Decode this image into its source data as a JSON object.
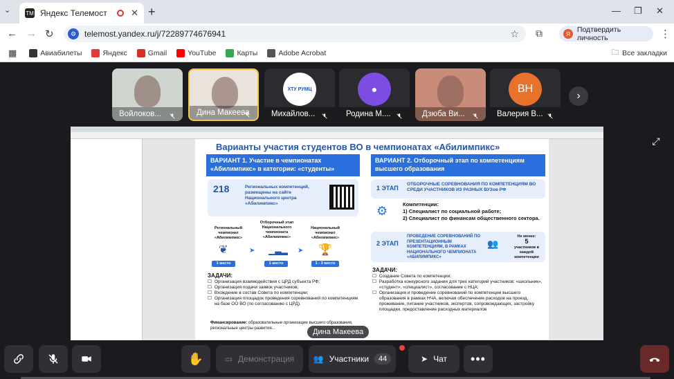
{
  "browser": {
    "tab_title": "Яндекс Телемост",
    "tab_icon": "TM",
    "url": "telemost.yandex.ru/j/72289774676941",
    "verify_label": "Подтвердить личность",
    "bookmarks": [
      {
        "label": "Авиабилеты",
        "icon": "plane-icon",
        "color": "#333333"
      },
      {
        "label": "Яндекс",
        "icon": "yandex-icon",
        "color": "#e03a3a"
      },
      {
        "label": "Gmail",
        "icon": "gmail-icon",
        "color": "#d93025"
      },
      {
        "label": "YouTube",
        "icon": "youtube-icon",
        "color": "#ff0000"
      },
      {
        "label": "Карты",
        "icon": "maps-icon",
        "color": "#34a853"
      },
      {
        "label": "Adobe Acrobat",
        "icon": "acrobat-icon",
        "color": "#555555"
      }
    ],
    "all_bookmarks": "Все закладки"
  },
  "participants": [
    {
      "name": "Войлоков...",
      "type": "photo",
      "color": "#cfd6cf"
    },
    {
      "name": "Дина Макеева",
      "type": "photo",
      "color": "#e9e3dc",
      "active": true
    },
    {
      "name": "Михайлов...",
      "type": "logo",
      "logo_text": "ХТУ РУМЦ",
      "color": "#ffffff"
    },
    {
      "name": "Родина М....",
      "type": "icon",
      "color": "#7b4de0"
    },
    {
      "name": "Дзюба Ви...",
      "type": "photo",
      "color": "#c98c7a"
    },
    {
      "name": "Валерия В...",
      "type": "initials",
      "initials": "ВН",
      "color": "#e8712c"
    }
  ],
  "slide": {
    "title": "Варианты участия студентов ВО в чемпионатах «Абилимпикс»",
    "variant1": "ВАРИАНТ 1. Участие в чемпионатах «Абилимпикс» в категории: «студенты»",
    "count": "218",
    "count_text": "Региональных компетенций, размещены на сайте Национального центра «Абилимпикс»",
    "step_regional": "Региональный чемпионат «Абилимпикс»",
    "step_qualify": "Отборочный этап Национального чемпионата «Абилимпикс»",
    "step_national": "Национальный чемпионат «Абилимпикс»",
    "badge1": "1 место",
    "badge2": "1 место",
    "badge3": "1 - 3 место",
    "variant2": "ВАРИАНТ 2. Отборочный этап по компетенциям высшего образования",
    "stage1_label": "1 ЭТАП",
    "stage1_text": "ОТБОРОЧНЫЕ СОРЕВНОВАНИЯ ПО КОМПЕТЕНЦИЯМ ВО СРЕДИ УЧАСТНИКОВ ИЗ РАЗНЫХ ВУЗов РФ",
    "comp_title": "Компетенции:",
    "comp1": "1) Специалист по социальной работе;",
    "comp2": "2) Специалист по финансам общественного сектора.",
    "stage2_label": "2 ЭТАП",
    "stage2_text": "ПРОВЕДЕНИЕ СОРЕВНОВАНИЙ ПО ПРЕЗЕНТАЦИОННЫМ КОМПЕТЕНЦИЯМ, В РАМКАХ НАЦИОНАЛЬНОГО ЧЕМПИОНАТА «АБИЛИМПИКС»",
    "min_label": "Не менее:",
    "min_num": "5",
    "min_text": "участников в каждой компетенции",
    "tasks_title": "ЗАДАЧИ:",
    "tasks": [
      "Организация взаимодействия с ЦРД субъекта РФ;",
      "Организация подачи заявок участников;",
      "Вхождение в состав Совета по компетенции;",
      "Организация площадок проведения соревнований по компетенциям на базе ОО ВО (по согласованию с ЦРД)."
    ],
    "tasks2_title": "ЗАДАЧИ:",
    "tasks2": [
      "Создание Совета по компетенции;",
      "Разработка конкурсного задания для трех категорий участников: «школьник», «студент», «специалист», согласование с НЦА;",
      "Организация и проведение соревнований по компетенции высшего образования в рамках НЧА, включая обеспечение расходов на проезд, проживание, питание участников, экспертов, сопровождающих, застройку площадки, предоставление расходных материалов"
    ],
    "finance_label": "Финансирование:",
    "finance_text": "образовательные организации высшего образования, региональные центры развития..."
  },
  "speaker_label": "Дина Макеева",
  "controls": {
    "demo_label": "Демонстрация",
    "participants_label": "Участники",
    "participants_count": "44",
    "chat_label": "Чат"
  }
}
